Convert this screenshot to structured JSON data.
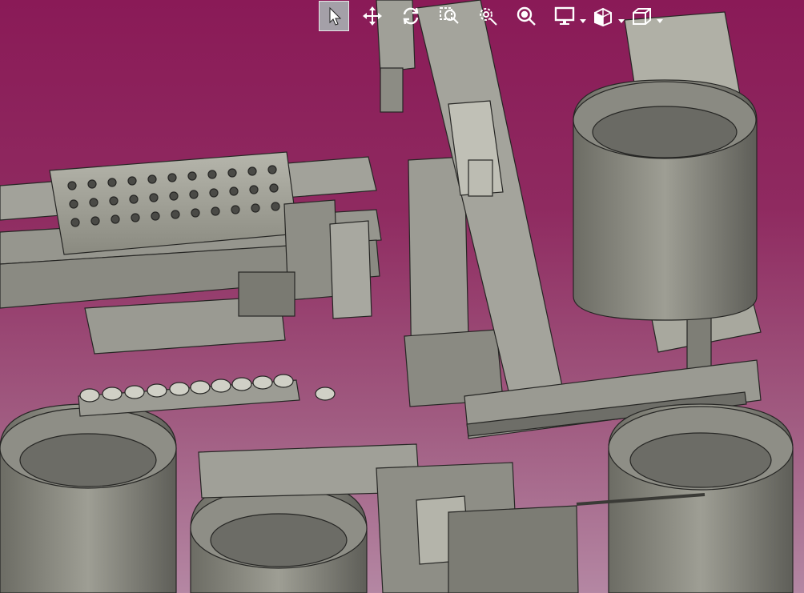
{
  "app": {
    "title": "",
    "viewport_background": {
      "top": "#8a1a57",
      "bottom": "#b487a3"
    }
  },
  "toolbar": {
    "buttons": [
      {
        "name": "select",
        "icon": "cursor-arrow-icon",
        "active": true
      },
      {
        "name": "pan",
        "icon": "move-arrows-icon",
        "active": false
      },
      {
        "name": "rotate",
        "icon": "rotate-icon",
        "active": false
      },
      {
        "name": "zoom-box",
        "icon": "zoom-box-icon",
        "active": false
      },
      {
        "name": "zoom-window",
        "icon": "zoom-window-icon",
        "active": false
      },
      {
        "name": "zoom",
        "icon": "zoom-icon",
        "active": false
      },
      {
        "name": "display-mode",
        "icon": "monitor-icon",
        "active": false,
        "has_dropdown": true
      },
      {
        "name": "view-orientation",
        "icon": "cube-view-icon",
        "active": false,
        "has_dropdown": true
      },
      {
        "name": "standard-views",
        "icon": "box-outline-icon",
        "active": false,
        "has_dropdown": true
      }
    ],
    "icon_color": "#ffffff",
    "active_bg": "#a4a0a8"
  },
  "model": {
    "description_icon": "cad-assembly-model",
    "colors": {
      "metal": "#8c8c82",
      "metal_light": "#b0b0a6",
      "metal_dark": "#5a5a54",
      "edge": "#2a2a28"
    }
  }
}
